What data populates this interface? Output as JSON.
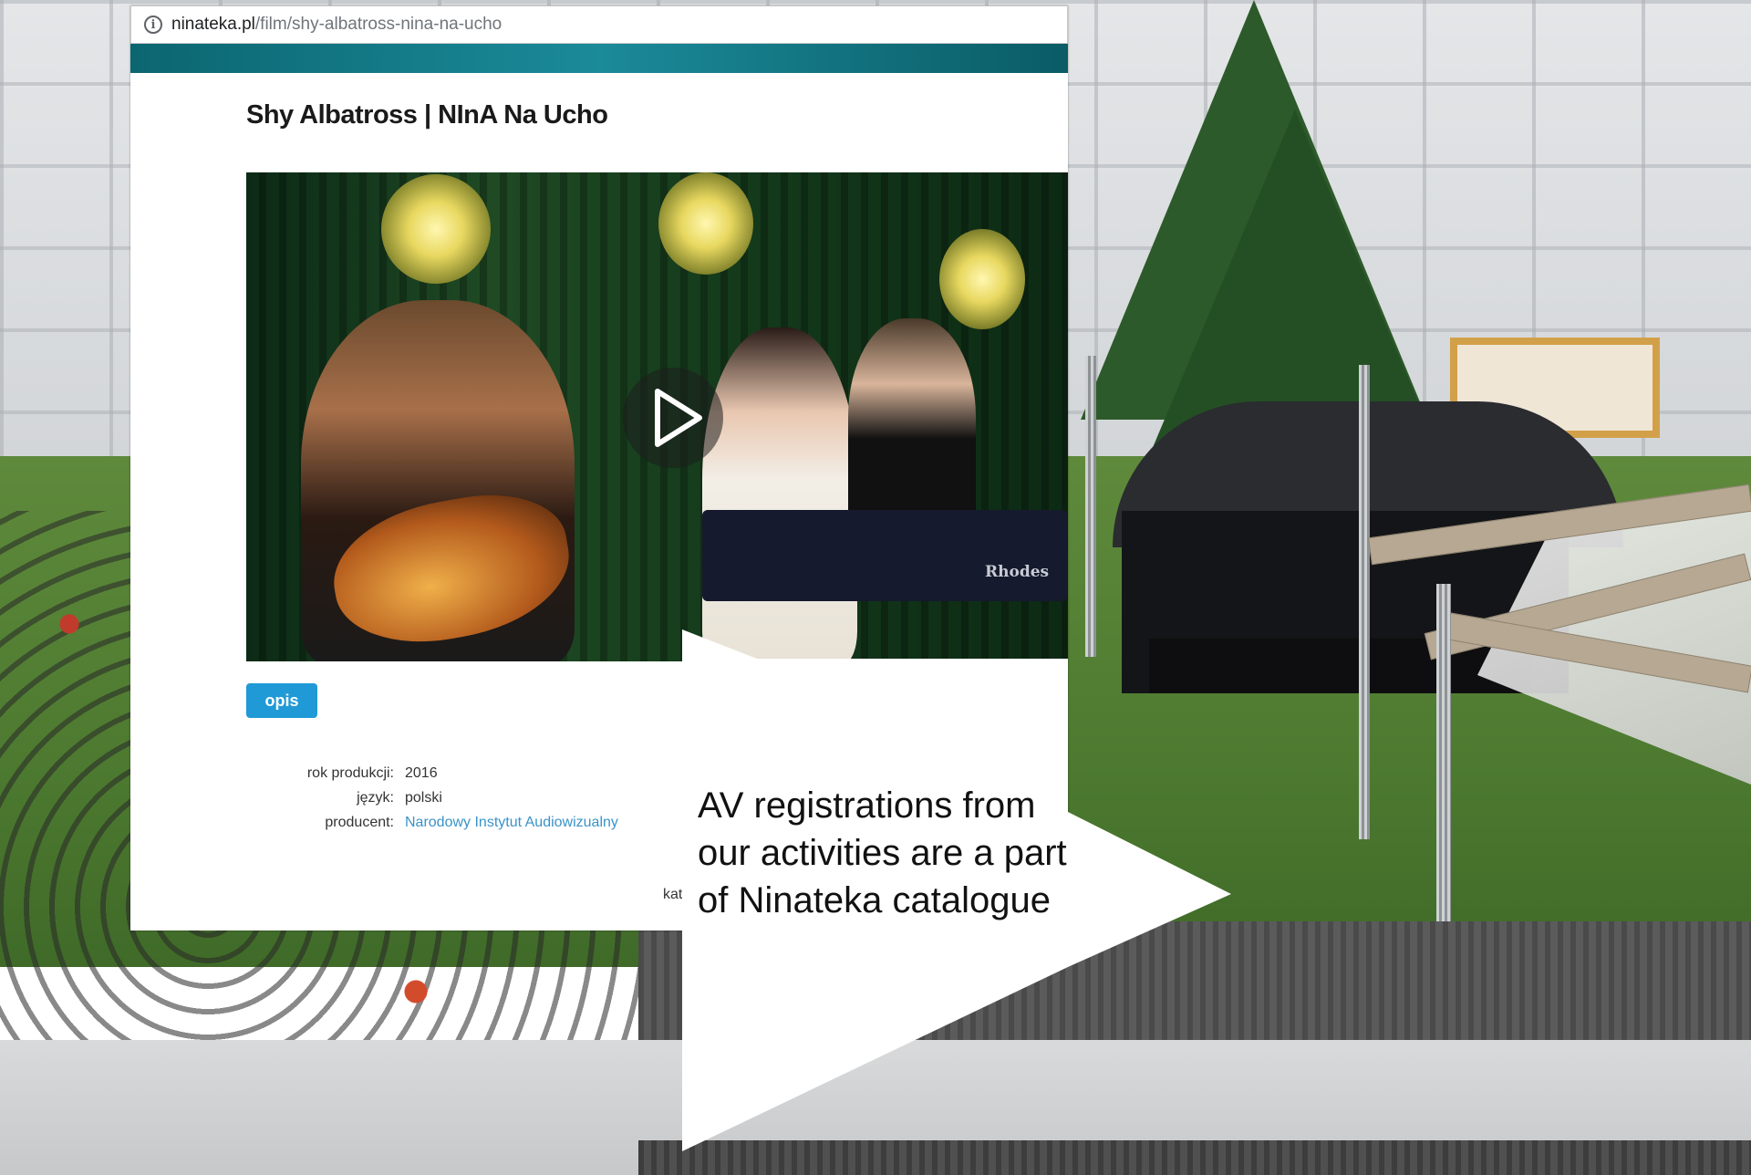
{
  "browser": {
    "url_domain": "ninateka.pl",
    "url_path": "/film/shy-albatross-nina-na-ucho"
  },
  "page": {
    "title": "Shy Albatross | NInA Na Ucho",
    "tab_label": "opis",
    "metadata": [
      {
        "label": "rok produkcji:",
        "value": "2016",
        "is_link": false
      },
      {
        "label": "język:",
        "value": "polski",
        "is_link": false
      },
      {
        "label": "producent:",
        "value": "Narodowy Instytut Audiowizualny",
        "is_link": true
      }
    ],
    "truncated_text": "kat"
  },
  "video": {
    "keyboard_brand": "Rhodes"
  },
  "callout": {
    "text": "AV registrations from our activities are a part of Ninateka catalogue"
  },
  "colors": {
    "accent": "#1f9ad6",
    "link": "#3a93c8",
    "header": "#0b6670"
  },
  "icons": {
    "address_info": "info-icon",
    "video_play": "play-icon"
  }
}
